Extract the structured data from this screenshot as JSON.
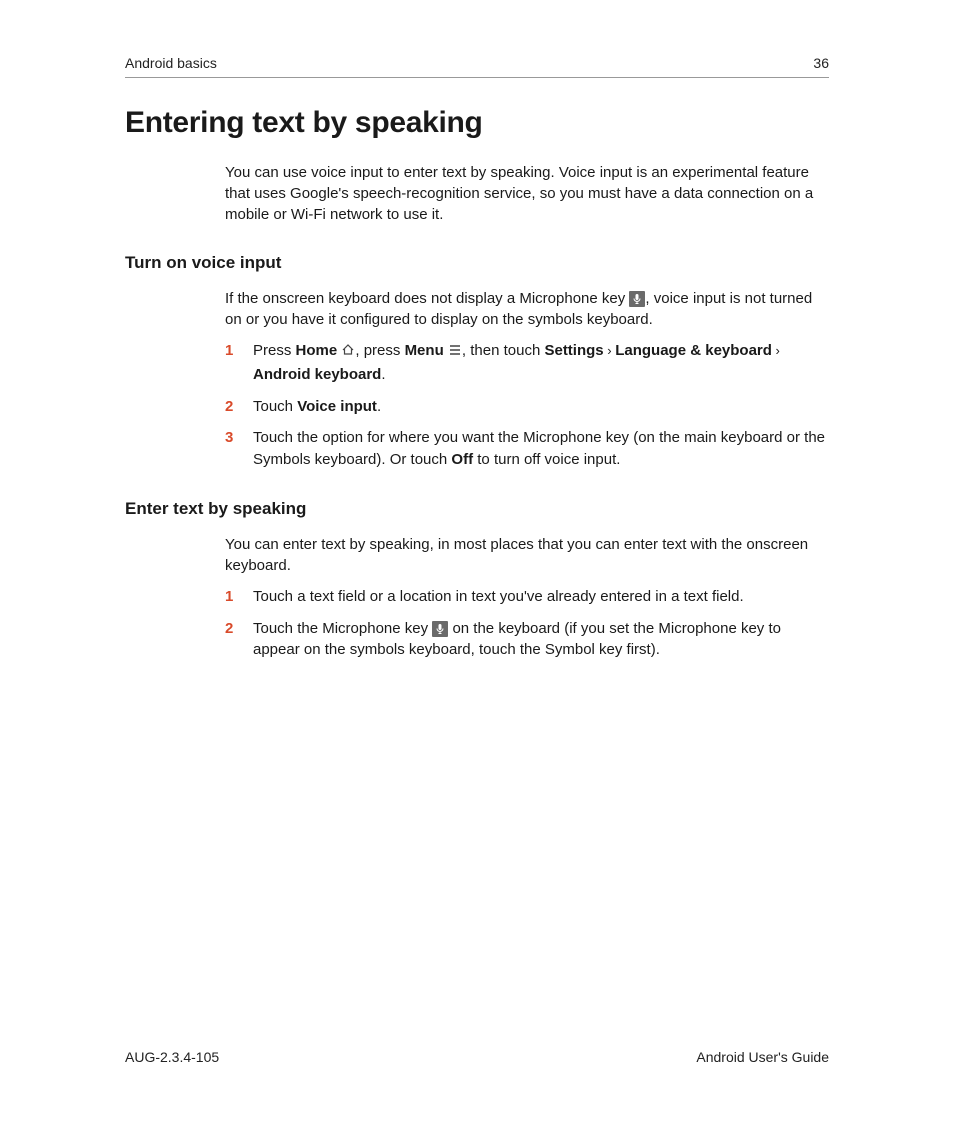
{
  "header": {
    "section": "Android basics",
    "page": "36"
  },
  "title": "Entering text by speaking",
  "intro": "You can use voice input to enter text by speaking. Voice input is an experimental feature that uses Google's speech-recognition service, so you must have a data connection on a mobile or Wi-Fi network to use it.",
  "section1": {
    "heading": "Turn on voice input",
    "body_a": "If the onscreen keyboard does not display a Microphone key ",
    "body_b": ", voice input is not turned on or you have it configured to display on the symbols keyboard.",
    "steps": {
      "s1_a": "Press ",
      "s1_home": "Home",
      "s1_b": ", press ",
      "s1_menu": "Menu",
      "s1_c": ", then touch ",
      "s1_settings": "Settings",
      "s1_d": " › ",
      "s1_lang": "Language & keyboard",
      "s1_e": " › ",
      "s1_android": "Android keyboard",
      "s1_f": ".",
      "s2_a": "Touch ",
      "s2_b": "Voice input",
      "s2_c": ".",
      "s3_a": "Touch the option for where you want the Microphone key (on the main keyboard or the Symbols keyboard). Or touch ",
      "s3_off": "Off",
      "s3_b": " to turn off voice input."
    }
  },
  "section2": {
    "heading": "Enter text by speaking",
    "body": "You can enter text by speaking, in most places that you can enter text with the onscreen keyboard.",
    "steps": {
      "s1": "Touch a text field or a location in text you've already entered in a text field.",
      "s2_a": "Touch the Microphone key ",
      "s2_b": " on the keyboard (if you set the Microphone key to appear on the symbols keyboard, touch the Symbol key first)."
    }
  },
  "footer": {
    "left": "AUG-2.3.4-105",
    "right": "Android User's Guide"
  }
}
